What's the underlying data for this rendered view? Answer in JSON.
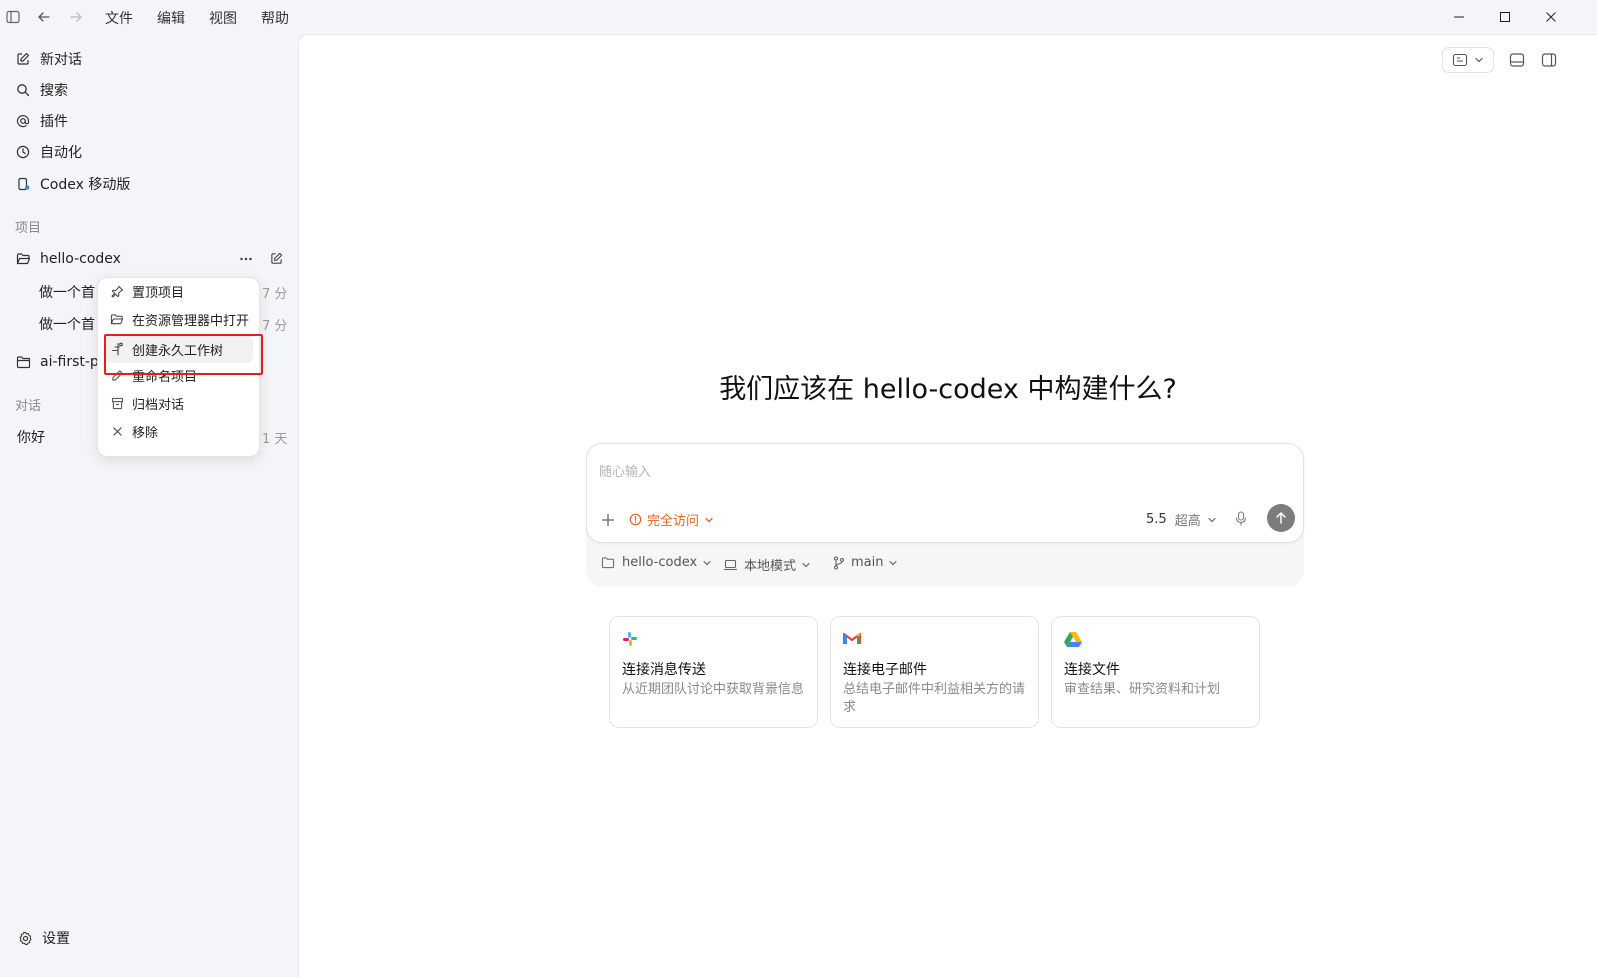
{
  "titlebar": {
    "menus": [
      "文件",
      "编辑",
      "视图",
      "帮助"
    ]
  },
  "sidebar": {
    "nav": [
      {
        "label": "新对话",
        "icon": "new-chat-icon"
      },
      {
        "label": "搜索",
        "icon": "search-icon"
      },
      {
        "label": "插件",
        "icon": "at-icon"
      },
      {
        "label": "自动化",
        "icon": "clock-icon"
      },
      {
        "label": "Codex 移动版",
        "icon": "mobile-icon"
      }
    ],
    "projects_label": "项目",
    "project_name": "hello-codex",
    "project_threads": [
      {
        "title": "做一个首",
        "time": "7 分"
      },
      {
        "title": "做一个首",
        "time": "7 分"
      }
    ],
    "project2_name": "ai-first-pa",
    "chats_label": "对话",
    "chats": [
      {
        "title": "你好",
        "time": "1 天"
      }
    ],
    "settings_label": "设置"
  },
  "context_menu": {
    "items": [
      "置顶项目",
      "在资源管理器中打开",
      "创建永久工作树",
      "重命名项目",
      "归档对话",
      "移除"
    ],
    "highlighted_index": 2
  },
  "main": {
    "headline": "我们应该在 hello-codex 中构建什么?",
    "composer": {
      "placeholder": "随心输入",
      "access_label": "完全访问",
      "model_version": "5.5",
      "model_effort": "超高"
    },
    "context_bar": {
      "project": "hello-codex",
      "mode": "本地模式",
      "branch": "main"
    },
    "cards": [
      {
        "title": "连接消息传送",
        "desc": "从近期团队讨论中获取背景信息",
        "icon": "slack-icon"
      },
      {
        "title": "连接电子邮件",
        "desc": "总结电子邮件中利益相关方的请求",
        "icon": "gmail-icon"
      },
      {
        "title": "连接文件",
        "desc": "审查结果、研究资料和计划",
        "icon": "drive-icon"
      }
    ]
  },
  "colors": {
    "accent_orange": "#e0651a",
    "highlight_red": "#e02020",
    "send_button": "#7c7c7c"
  }
}
